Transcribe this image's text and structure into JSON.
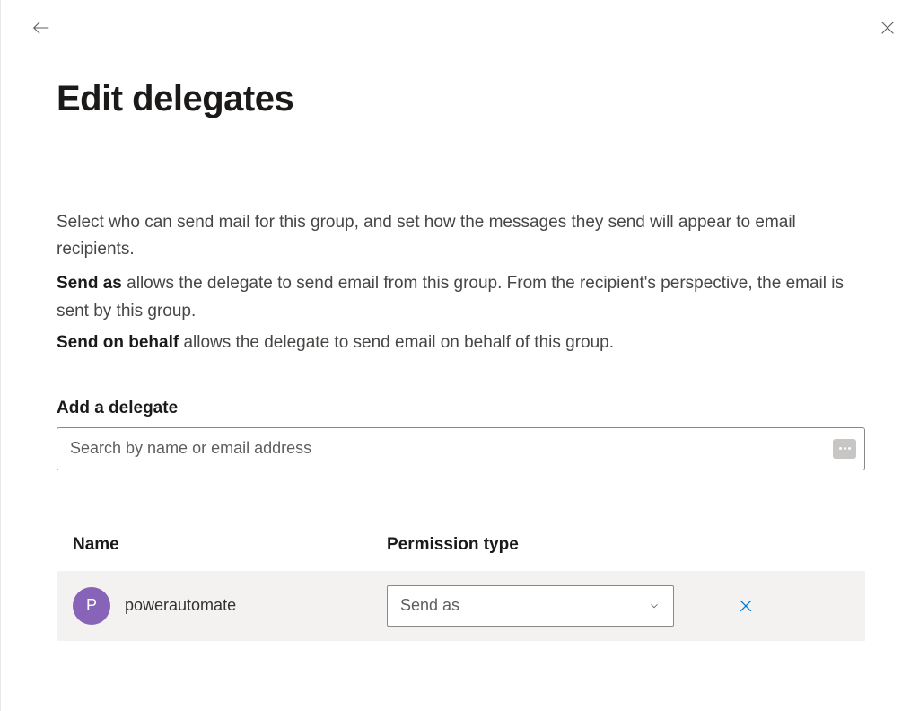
{
  "header": {
    "title": "Edit delegates"
  },
  "description": {
    "intro": "Select who can send mail for this group, and set how the messages they send will appear to email recipients.",
    "send_as_label": "Send as",
    "send_as_text": " allows the delegate to send email from this group. From the recipient's perspective, the email is sent by this group.",
    "send_behalf_label": "Send on behalf",
    "send_behalf_text": " allows the delegate to send email on behalf of this group."
  },
  "add_delegate": {
    "label": "Add a delegate",
    "placeholder": "Search by name or email address"
  },
  "table": {
    "columns": {
      "name": "Name",
      "permission": "Permission type"
    },
    "rows": [
      {
        "avatar_initial": "P",
        "name": "powerautomate",
        "permission": "Send as"
      }
    ]
  }
}
